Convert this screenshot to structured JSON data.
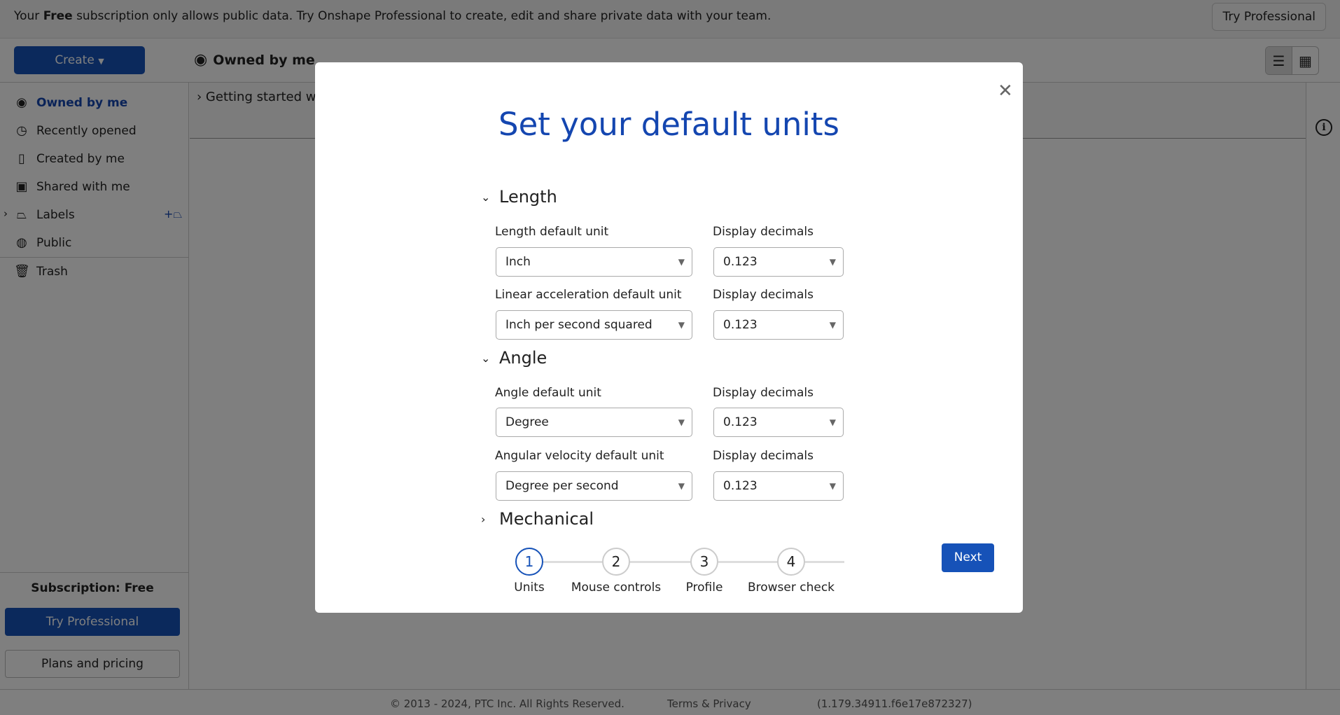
{
  "banner": {
    "text_pre": "Your ",
    "text_bold": "Free",
    "text_post": " subscription only allows public data. Try Onshape Professional to create, edit and share private data with your team.",
    "button": "Try Professional"
  },
  "topbar": {
    "create": "Create",
    "heading": "Owned by me"
  },
  "sidebar": {
    "items": [
      {
        "label": "Owned by me",
        "icon": "user-circle-icon",
        "active": true
      },
      {
        "label": "Recently opened",
        "icon": "clock-icon"
      },
      {
        "label": "Created by me",
        "icon": "document-icon"
      },
      {
        "label": "Shared with me",
        "icon": "shared-doc-icon"
      },
      {
        "label": "Labels",
        "icon": "tag-icon"
      },
      {
        "label": "Public",
        "icon": "globe-icon"
      },
      {
        "label": "Trash",
        "icon": "trash-icon"
      }
    ],
    "subscription": "Subscription: Free",
    "try_professional": "Try Professional",
    "plans": "Plans and pricing"
  },
  "content": {
    "row": "Getting started with"
  },
  "footer": {
    "copyright": "© 2013 - 2024, PTC Inc. All Rights Reserved.",
    "terms": "Terms & Privacy",
    "version": "(1.179.34911.f6e17e872327)"
  },
  "modal": {
    "title": "Set your default units",
    "sections": [
      {
        "title": "Length",
        "expanded": true
      },
      {
        "title": "Angle",
        "expanded": true
      },
      {
        "title": "Mechanical",
        "expanded": false
      }
    ],
    "fields": [
      {
        "label": "Length default unit",
        "value": "Inch",
        "dec_label": "Display decimals",
        "dec_value": "0.123"
      },
      {
        "label": "Linear acceleration default unit",
        "value": "Inch per second squared",
        "dec_label": "Display decimals",
        "dec_value": "0.123"
      },
      {
        "label": "Angle default unit",
        "value": "Degree",
        "dec_label": "Display decimals",
        "dec_value": "0.123"
      },
      {
        "label": "Angular velocity default unit",
        "value": "Degree per second",
        "dec_label": "Display decimals",
        "dec_value": "0.123"
      }
    ],
    "steps": [
      {
        "num": "1",
        "label": "Units",
        "active": true
      },
      {
        "num": "2",
        "label": "Mouse controls"
      },
      {
        "num": "3",
        "label": "Profile"
      },
      {
        "num": "4",
        "label": "Browser check"
      }
    ],
    "next": "Next"
  },
  "colors": {
    "accent": "#1652b8",
    "title": "#1446b0"
  }
}
